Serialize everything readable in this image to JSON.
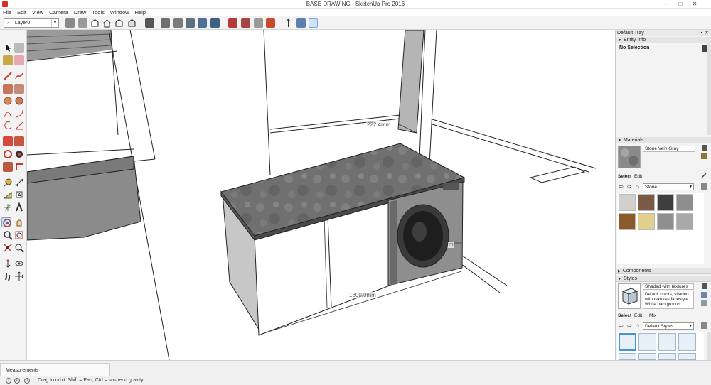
{
  "window": {
    "title": "BASE DRAWING - SketchUp Pro 2016",
    "minimize": "–",
    "maximize": "□",
    "close": "✕"
  },
  "menu": [
    "File",
    "Edit",
    "View",
    "Camera",
    "Draw",
    "Tools",
    "Window",
    "Help"
  ],
  "toolbar": {
    "layer_check": "✓",
    "layer_name": "Layer0"
  },
  "viewport": {
    "dimensions": [
      "222.4mm",
      "1800.0mm",
      "m"
    ]
  },
  "tray": {
    "title": "Default Tray",
    "entity_info": {
      "header": "Entity Info",
      "selection": "No Selection"
    },
    "materials": {
      "header": "Materials",
      "current_name": "Stone Vein Gray",
      "tabs": [
        "Select",
        "Edit"
      ],
      "collection": "Stone",
      "swatch_colors": [
        "#d2d0cc",
        "#7a5a44",
        "#3e3e3e",
        "#8e8e8e",
        "#8a5a2a",
        "#e2cf8e",
        "#8f8f8f",
        "#a9a9a9"
      ]
    },
    "components": {
      "header": "Components"
    },
    "styles": {
      "header": "Styles",
      "current_name": "Shaded with textures",
      "description": "Default colors, shaded with textures facestyle. White background.",
      "tabs": [
        "Select",
        "Edit",
        "Mix"
      ],
      "collection": "Default Styles"
    }
  },
  "status": {
    "measurements_label": "Measurements",
    "hint": "Drag to orbit. Shift = Pan, Ctrl = suspend gravity."
  },
  "colors": {
    "counter_top": "#6f6f6f",
    "washer_body": "#8e8e8e",
    "selection_blue": "#cfe3f6"
  }
}
